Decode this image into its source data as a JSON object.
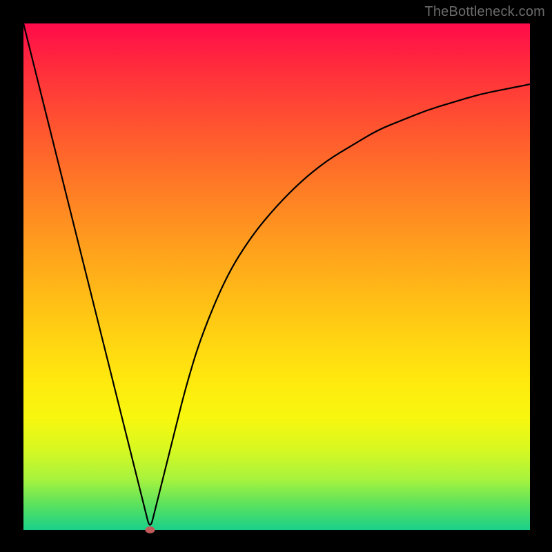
{
  "watermark": {
    "text": "TheBottleneck.com"
  },
  "chart_data": {
    "type": "line",
    "title": "",
    "xlabel": "",
    "ylabel": "",
    "xlim": [
      0,
      100
    ],
    "ylim": [
      0,
      100
    ],
    "grid": false,
    "legend": false,
    "background": {
      "type": "vertical-gradient",
      "stops": [
        {
          "pos": 0,
          "color": "#ff0b4a"
        },
        {
          "pos": 50,
          "color": "#ffa800"
        },
        {
          "pos": 78,
          "color": "#f5f510"
        },
        {
          "pos": 100,
          "color": "#19d08a"
        }
      ]
    },
    "series": [
      {
        "name": "bottleneck-curve",
        "color": "#000000",
        "x": [
          0,
          2,
          4,
          6,
          8,
          10,
          12,
          14,
          16,
          18,
          20,
          22,
          24,
          25,
          26,
          28,
          30,
          32,
          35,
          40,
          45,
          50,
          55,
          60,
          65,
          70,
          75,
          80,
          85,
          90,
          95,
          100
        ],
        "y": [
          100,
          92,
          84,
          76,
          68,
          60,
          52,
          44,
          36,
          28,
          20,
          12,
          4,
          0,
          4,
          12,
          20,
          28,
          38,
          50,
          58,
          64,
          69,
          73,
          76,
          79,
          81,
          83,
          84.5,
          86,
          87,
          88
        ]
      }
    ],
    "markers": [
      {
        "name": "optimal-point",
        "x": 25,
        "y": 0,
        "color": "#c05a5a",
        "shape": "ellipse"
      }
    ]
  }
}
